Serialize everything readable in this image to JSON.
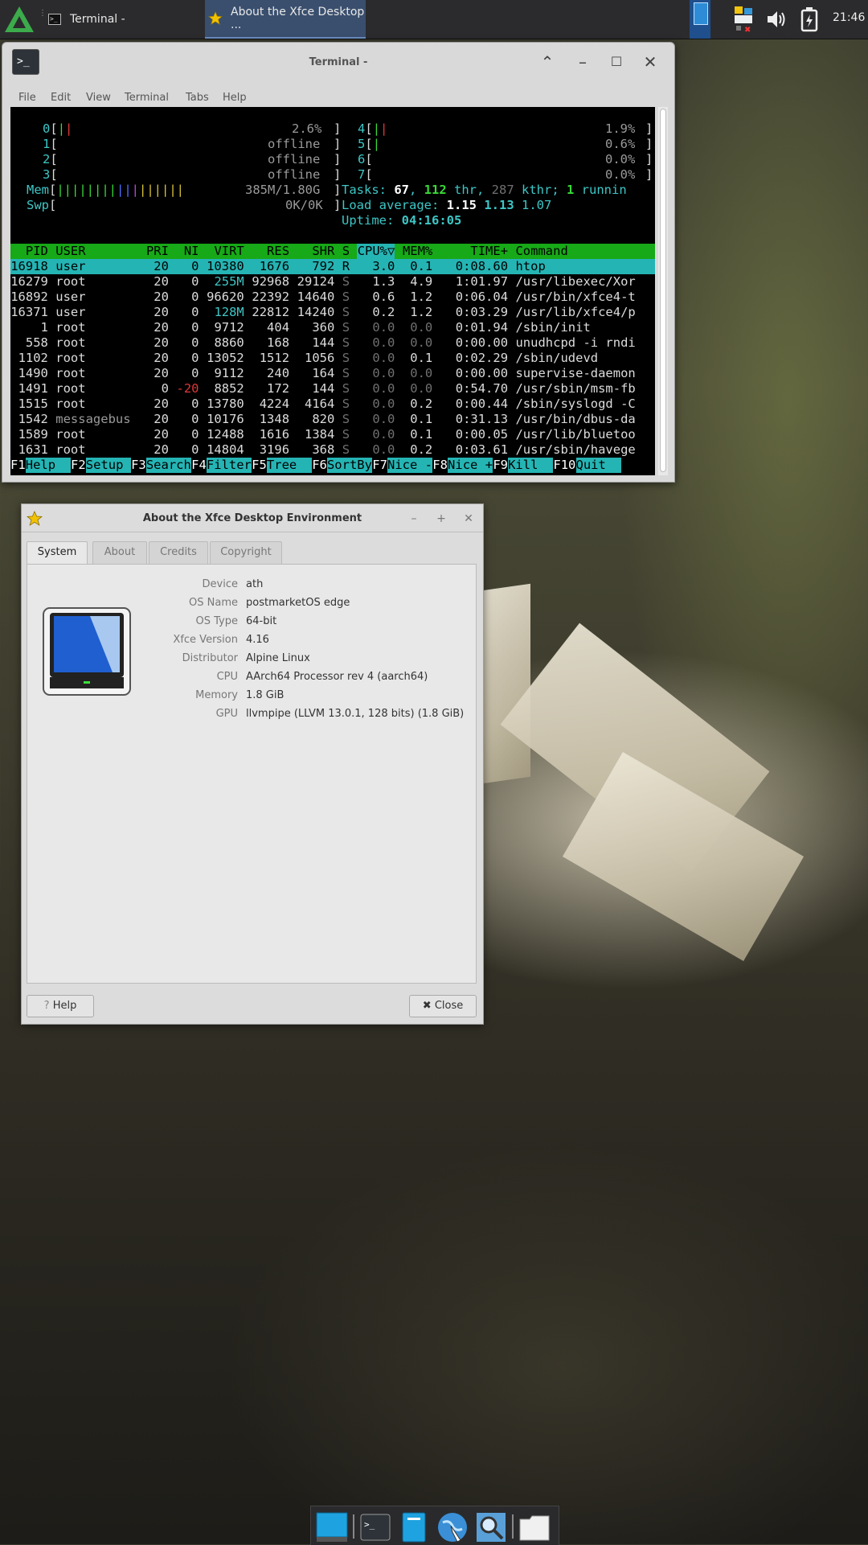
{
  "top_panel": {
    "tasks": [
      {
        "label": "Terminal -",
        "icon": "terminal-icon",
        "active": false
      },
      {
        "label": "About the Xfce Desktop ...",
        "icon": "star-icon",
        "active": true
      }
    ],
    "clock": "21:46"
  },
  "terminal": {
    "title": "Terminal -",
    "menu": [
      "File",
      "Edit",
      "View",
      "Terminal",
      "Tabs",
      "Help"
    ],
    "htop": {
      "cpus": [
        {
          "id": "0",
          "value": "2.6%"
        },
        {
          "id": "1",
          "value": "offline"
        },
        {
          "id": "2",
          "value": "offline"
        },
        {
          "id": "3",
          "value": "offline"
        },
        {
          "id": "4",
          "value": "1.9%"
        },
        {
          "id": "5",
          "value": "0.6%"
        },
        {
          "id": "6",
          "value": "0.0%"
        },
        {
          "id": "7",
          "value": "0.0%"
        }
      ],
      "mem": "385M/1.80G",
      "swp": "0K/0K",
      "tasks": "67",
      "threads": "112",
      "kthreads": "287",
      "running": "1",
      "load_average": [
        "1.15",
        "1.13",
        "1.07"
      ],
      "uptime": "04:16:05",
      "columns": [
        "PID",
        "USER",
        "PRI",
        "NI",
        "VIRT",
        "RES",
        "SHR",
        "S",
        "CPU%",
        "MEM%",
        "TIME+",
        "Command"
      ],
      "processes": [
        {
          "pid": "16918",
          "user": "user",
          "pri": "20",
          "ni": "0",
          "virt": "10380",
          "res": "1676",
          "shr": "792",
          "s": "R",
          "cpu": "3.0",
          "mem": "0.1",
          "time": "0:08.60",
          "cmd": "htop"
        },
        {
          "pid": "16279",
          "user": "root",
          "pri": "20",
          "ni": "0",
          "virt": "255M",
          "res": "92968",
          "shr": "29124",
          "s": "S",
          "cpu": "1.3",
          "mem": "4.9",
          "time": "1:01.97",
          "cmd": "/usr/libexec/Xor"
        },
        {
          "pid": "16892",
          "user": "user",
          "pri": "20",
          "ni": "0",
          "virt": "96620",
          "res": "22392",
          "shr": "14640",
          "s": "S",
          "cpu": "0.6",
          "mem": "1.2",
          "time": "0:06.04",
          "cmd": "/usr/bin/xfce4-t"
        },
        {
          "pid": "16371",
          "user": "user",
          "pri": "20",
          "ni": "0",
          "virt": "128M",
          "res": "22812",
          "shr": "14240",
          "s": "S",
          "cpu": "0.2",
          "mem": "1.2",
          "time": "0:03.29",
          "cmd": "/usr/lib/xfce4/p"
        },
        {
          "pid": "1",
          "user": "root",
          "pri": "20",
          "ni": "0",
          "virt": "9712",
          "res": "404",
          "shr": "360",
          "s": "S",
          "cpu": "0.0",
          "mem": "0.0",
          "time": "0:01.94",
          "cmd": "/sbin/init"
        },
        {
          "pid": "558",
          "user": "root",
          "pri": "20",
          "ni": "0",
          "virt": "8860",
          "res": "168",
          "shr": "144",
          "s": "S",
          "cpu": "0.0",
          "mem": "0.0",
          "time": "0:00.00",
          "cmd": "unudhcpd -i rndi"
        },
        {
          "pid": "1102",
          "user": "root",
          "pri": "20",
          "ni": "0",
          "virt": "13052",
          "res": "1512",
          "shr": "1056",
          "s": "S",
          "cpu": "0.0",
          "mem": "0.1",
          "time": "0:02.29",
          "cmd": "/sbin/udevd"
        },
        {
          "pid": "1490",
          "user": "root",
          "pri": "20",
          "ni": "0",
          "virt": "9112",
          "res": "240",
          "shr": "164",
          "s": "S",
          "cpu": "0.0",
          "mem": "0.0",
          "time": "0:00.00",
          "cmd": "supervise-daemon"
        },
        {
          "pid": "1491",
          "user": "root",
          "pri": "0",
          "ni": "-20",
          "virt": "8852",
          "res": "172",
          "shr": "144",
          "s": "S",
          "cpu": "0.0",
          "mem": "0.0",
          "time": "0:54.70",
          "cmd": "/usr/sbin/msm-fb"
        },
        {
          "pid": "1515",
          "user": "root",
          "pri": "20",
          "ni": "0",
          "virt": "13780",
          "res": "4224",
          "shr": "4164",
          "s": "S",
          "cpu": "0.0",
          "mem": "0.2",
          "time": "0:00.44",
          "cmd": "/sbin/syslogd -C"
        },
        {
          "pid": "1542",
          "user": "messagebus",
          "pri": "20",
          "ni": "0",
          "virt": "10176",
          "res": "1348",
          "shr": "820",
          "s": "S",
          "cpu": "0.0",
          "mem": "0.1",
          "time": "0:31.13",
          "cmd": "/usr/bin/dbus-da"
        },
        {
          "pid": "1589",
          "user": "root",
          "pri": "20",
          "ni": "0",
          "virt": "12488",
          "res": "1616",
          "shr": "1384",
          "s": "S",
          "cpu": "0.0",
          "mem": "0.1",
          "time": "0:00.05",
          "cmd": "/usr/lib/bluetoo"
        },
        {
          "pid": "1631",
          "user": "root",
          "pri": "20",
          "ni": "0",
          "virt": "14804",
          "res": "3196",
          "shr": "368",
          "s": "S",
          "cpu": "0.0",
          "mem": "0.2",
          "time": "0:03.61",
          "cmd": "/usr/sbin/havege"
        }
      ],
      "function_keys": [
        {
          "key": "F1",
          "label": "Help"
        },
        {
          "key": "F2",
          "label": "Setup"
        },
        {
          "key": "F3",
          "label": "Search"
        },
        {
          "key": "F4",
          "label": "Filter"
        },
        {
          "key": "F5",
          "label": "Tree"
        },
        {
          "key": "F6",
          "label": "SortBy"
        },
        {
          "key": "F7",
          "label": "Nice -"
        },
        {
          "key": "F8",
          "label": "Nice +"
        },
        {
          "key": "F9",
          "label": "Kill"
        },
        {
          "key": "F10",
          "label": "Quit"
        }
      ]
    }
  },
  "about": {
    "title": "About the Xfce Desktop Environment",
    "tabs": [
      "System",
      "About",
      "Credits",
      "Copyright"
    ],
    "info": [
      {
        "key": "Device",
        "value": "ath"
      },
      {
        "key": "OS Name",
        "value": "postmarketOS edge"
      },
      {
        "key": "OS Type",
        "value": "64-bit"
      },
      {
        "key": "Xfce Version",
        "value": "4.16"
      },
      {
        "key": "Distributor",
        "value": "Alpine Linux"
      },
      {
        "key": "CPU",
        "value": "AArch64 Processor rev 4 (aarch64)"
      },
      {
        "key": "Memory",
        "value": "1.8 GiB"
      },
      {
        "key": "GPU",
        "value": "llvmpipe (LLVM 13.0.1, 128 bits) (1.8 GiB)"
      }
    ],
    "help_label": "Help",
    "close_label": "Close"
  },
  "colors": {
    "htop_header": "#17a917",
    "htop_selected": "#25b4b4",
    "panel": "#2b2b2d",
    "active_task": "#3a4f6e"
  }
}
